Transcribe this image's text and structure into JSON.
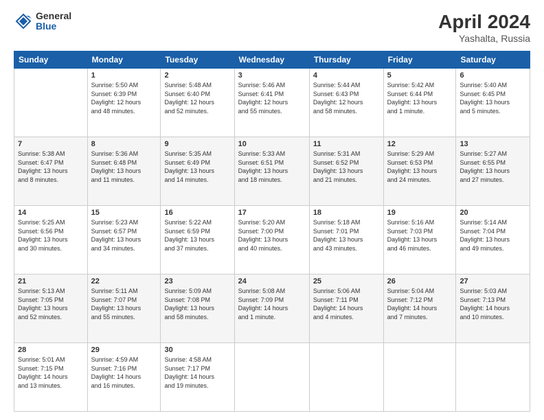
{
  "header": {
    "logo_general": "General",
    "logo_blue": "Blue",
    "title": "April 2024",
    "location": "Yashalta, Russia"
  },
  "days_of_week": [
    "Sunday",
    "Monday",
    "Tuesday",
    "Wednesday",
    "Thursday",
    "Friday",
    "Saturday"
  ],
  "weeks": [
    [
      {
        "day": "",
        "info": ""
      },
      {
        "day": "1",
        "info": "Sunrise: 5:50 AM\nSunset: 6:39 PM\nDaylight: 12 hours\nand 48 minutes."
      },
      {
        "day": "2",
        "info": "Sunrise: 5:48 AM\nSunset: 6:40 PM\nDaylight: 12 hours\nand 52 minutes."
      },
      {
        "day": "3",
        "info": "Sunrise: 5:46 AM\nSunset: 6:41 PM\nDaylight: 12 hours\nand 55 minutes."
      },
      {
        "day": "4",
        "info": "Sunrise: 5:44 AM\nSunset: 6:43 PM\nDaylight: 12 hours\nand 58 minutes."
      },
      {
        "day": "5",
        "info": "Sunrise: 5:42 AM\nSunset: 6:44 PM\nDaylight: 13 hours\nand 1 minute."
      },
      {
        "day": "6",
        "info": "Sunrise: 5:40 AM\nSunset: 6:45 PM\nDaylight: 13 hours\nand 5 minutes."
      }
    ],
    [
      {
        "day": "7",
        "info": "Sunrise: 5:38 AM\nSunset: 6:47 PM\nDaylight: 13 hours\nand 8 minutes."
      },
      {
        "day": "8",
        "info": "Sunrise: 5:36 AM\nSunset: 6:48 PM\nDaylight: 13 hours\nand 11 minutes."
      },
      {
        "day": "9",
        "info": "Sunrise: 5:35 AM\nSunset: 6:49 PM\nDaylight: 13 hours\nand 14 minutes."
      },
      {
        "day": "10",
        "info": "Sunrise: 5:33 AM\nSunset: 6:51 PM\nDaylight: 13 hours\nand 18 minutes."
      },
      {
        "day": "11",
        "info": "Sunrise: 5:31 AM\nSunset: 6:52 PM\nDaylight: 13 hours\nand 21 minutes."
      },
      {
        "day": "12",
        "info": "Sunrise: 5:29 AM\nSunset: 6:53 PM\nDaylight: 13 hours\nand 24 minutes."
      },
      {
        "day": "13",
        "info": "Sunrise: 5:27 AM\nSunset: 6:55 PM\nDaylight: 13 hours\nand 27 minutes."
      }
    ],
    [
      {
        "day": "14",
        "info": "Sunrise: 5:25 AM\nSunset: 6:56 PM\nDaylight: 13 hours\nand 30 minutes."
      },
      {
        "day": "15",
        "info": "Sunrise: 5:23 AM\nSunset: 6:57 PM\nDaylight: 13 hours\nand 34 minutes."
      },
      {
        "day": "16",
        "info": "Sunrise: 5:22 AM\nSunset: 6:59 PM\nDaylight: 13 hours\nand 37 minutes."
      },
      {
        "day": "17",
        "info": "Sunrise: 5:20 AM\nSunset: 7:00 PM\nDaylight: 13 hours\nand 40 minutes."
      },
      {
        "day": "18",
        "info": "Sunrise: 5:18 AM\nSunset: 7:01 PM\nDaylight: 13 hours\nand 43 minutes."
      },
      {
        "day": "19",
        "info": "Sunrise: 5:16 AM\nSunset: 7:03 PM\nDaylight: 13 hours\nand 46 minutes."
      },
      {
        "day": "20",
        "info": "Sunrise: 5:14 AM\nSunset: 7:04 PM\nDaylight: 13 hours\nand 49 minutes."
      }
    ],
    [
      {
        "day": "21",
        "info": "Sunrise: 5:13 AM\nSunset: 7:05 PM\nDaylight: 13 hours\nand 52 minutes."
      },
      {
        "day": "22",
        "info": "Sunrise: 5:11 AM\nSunset: 7:07 PM\nDaylight: 13 hours\nand 55 minutes."
      },
      {
        "day": "23",
        "info": "Sunrise: 5:09 AM\nSunset: 7:08 PM\nDaylight: 13 hours\nand 58 minutes."
      },
      {
        "day": "24",
        "info": "Sunrise: 5:08 AM\nSunset: 7:09 PM\nDaylight: 14 hours\nand 1 minute."
      },
      {
        "day": "25",
        "info": "Sunrise: 5:06 AM\nSunset: 7:11 PM\nDaylight: 14 hours\nand 4 minutes."
      },
      {
        "day": "26",
        "info": "Sunrise: 5:04 AM\nSunset: 7:12 PM\nDaylight: 14 hours\nand 7 minutes."
      },
      {
        "day": "27",
        "info": "Sunrise: 5:03 AM\nSunset: 7:13 PM\nDaylight: 14 hours\nand 10 minutes."
      }
    ],
    [
      {
        "day": "28",
        "info": "Sunrise: 5:01 AM\nSunset: 7:15 PM\nDaylight: 14 hours\nand 13 minutes."
      },
      {
        "day": "29",
        "info": "Sunrise: 4:59 AM\nSunset: 7:16 PM\nDaylight: 14 hours\nand 16 minutes."
      },
      {
        "day": "30",
        "info": "Sunrise: 4:58 AM\nSunset: 7:17 PM\nDaylight: 14 hours\nand 19 minutes."
      },
      {
        "day": "",
        "info": ""
      },
      {
        "day": "",
        "info": ""
      },
      {
        "day": "",
        "info": ""
      },
      {
        "day": "",
        "info": ""
      }
    ]
  ]
}
